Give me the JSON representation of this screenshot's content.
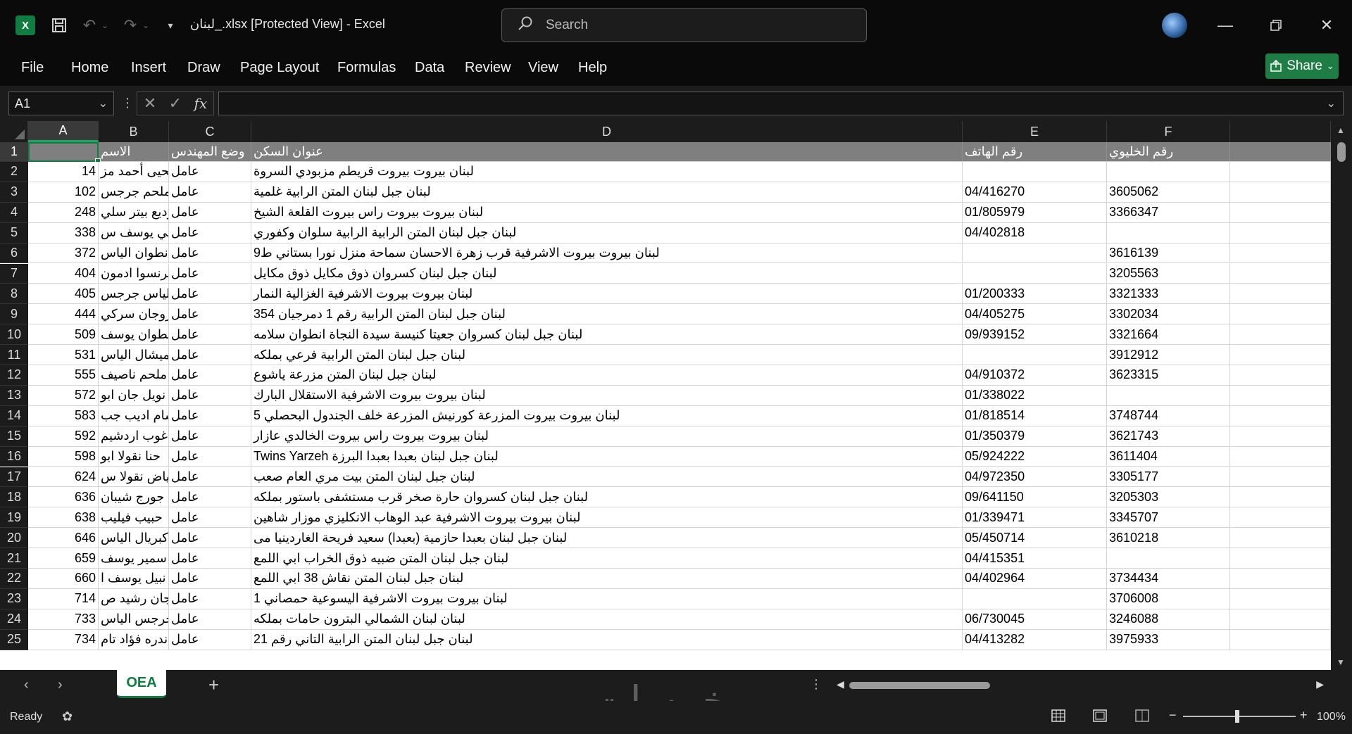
{
  "window": {
    "title": "لبنان_.xlsx  [Protected View]  -  Excel",
    "search_placeholder": "Search"
  },
  "menu": [
    "File",
    "Home",
    "Insert",
    "Draw",
    "Page Layout",
    "Formulas",
    "Data",
    "Review",
    "View",
    "Help"
  ],
  "share_label": "Share",
  "formula_bar": {
    "name_box": "A1",
    "fx": "fx",
    "content": ""
  },
  "columns": [
    "A",
    "B",
    "C",
    "D",
    "E",
    "F"
  ],
  "header_row": {
    "A": "",
    "B": "الاسم",
    "C": "وضع المهندس",
    "D": "عنوان السكن",
    "E": "رقم الهاتف",
    "F": "رقم الخليوي"
  },
  "rows": [
    {
      "n": "2",
      "a": "14",
      "b": "يحيى أحمد مز",
      "c": "عامل",
      "d": "لبنان  بيروت  بيروت  قريطم   مزبودي  السروة",
      "e": "",
      "f": ""
    },
    {
      "n": "3",
      "a": "102",
      "b": "ملحم جرجس",
      "c": "عامل",
      "d": "لبنان  جبل لبنان  المتن  الرابية  غلمية",
      "e": "04/416270",
      "f": "3605062"
    },
    {
      "n": "4",
      "a": "248",
      "b": "وديع بيتر سلي",
      "c": "عامل",
      "d": "لبنان  بيروت  بيروت  راس بيروت  القلعة  الشيخ",
      "e": "01/805979",
      "f": "3366347"
    },
    {
      "n": "5",
      "a": "338",
      "b": "ايلي يوسف س",
      "c": "عامل",
      "d": "لبنان  جبل لبنان  المتن  الرابية  الرابية  سلوان وكفوري",
      "e": "04/402818",
      "f": ""
    },
    {
      "n": "6",
      "a": "372",
      "b": "انطوان الياس",
      "c": "عامل",
      "d": "لبنان  بيروت  بيروت  الاشرفية  قرب زهرة الاحسان  سماحة   منزل نورا بستاني ط9",
      "e": "",
      "f": "3616139"
    },
    {
      "n": "7",
      "a": "404",
      "b": "فرنسوا ادمون",
      "c": "عامل",
      "d": "لبنان  جبل لبنان  كسروان  ذوق مكايل  ذوق مكايل",
      "e": "",
      "f": "3205563"
    },
    {
      "n": "8",
      "a": "405",
      "b": "الياس جرجس",
      "c": "عامل",
      "d": "لبنان  بيروت  بيروت  الاشرفية  الغزالية  النمار",
      "e": "01/200333",
      "f": "3321333"
    },
    {
      "n": "9",
      "a": "444",
      "b": "واروجان سركي",
      "c": "عامل",
      "d": "لبنان  جبل لبنان  المتن  الرابية  رقم 1   دمرجيان 354",
      "e": "04/405275",
      "f": "3302034"
    },
    {
      "n": "10",
      "a": "509",
      "b": "انطوان يوسف",
      "c": "عامل",
      "d": "لبنان  جبل لبنان  كسروان  جعيتا  كنيسة سيدة النجاة  انطوان سلامه",
      "e": "09/939152",
      "f": "3321664"
    },
    {
      "n": "11",
      "a": "531",
      "b": "ميشال الياس",
      "c": "عامل",
      "d": "لبنان  جبل لبنان  المتن  الرابية  فرعي  بملكه",
      "e": "",
      "f": "3912912"
    },
    {
      "n": "12",
      "a": "555",
      "b": "ملحم ناصيف",
      "c": "عامل",
      "d": "لبنان  جبل لبنان  المتن  مزرعة ياشوع",
      "e": "04/910372",
      "f": "3623315"
    },
    {
      "n": "13",
      "a": "572",
      "b": "نويل جان ابو",
      "c": "عامل",
      "d": "لبنان  بيروت  بيروت  الاشرفية  الاستقلال  البارك",
      "e": "01/338022",
      "f": ""
    },
    {
      "n": "14",
      "a": "583",
      "b": "بسام اديب جب",
      "c": "عامل",
      "d": "لبنان  بيروت  بيروت  المزرعة  كورنيش المزرعة   خلف الجندول  البحصلي  5",
      "e": "01/818514",
      "f": "3748744"
    },
    {
      "n": "15",
      "a": "592",
      "b": "اغوب اردشيم",
      "c": "عامل",
      "d": "لبنان  بيروت  بيروت  راس بيروت  الخالدي  عازار",
      "e": "01/350379",
      "f": "3621743"
    },
    {
      "n": "16",
      "a": "598",
      "b": "حنا نقولا ابو",
      "c": "عامل",
      "d": "لبنان  جبل لبنان  بعبدا  بعبدا  البرزة  Twins Yarzeh",
      "e": "05/924222",
      "f": "3611404"
    },
    {
      "n": "17",
      "a": "624",
      "b": "رياض نقولا س",
      "c": "عامل",
      "d": "لبنان  جبل لبنان  المتن  بيت مري  العام  صعب",
      "e": "04/972350",
      "f": "3305177"
    },
    {
      "n": "18",
      "a": "636",
      "b": "جورج شيبان",
      "c": "عامل",
      "d": "لبنان  جبل لبنان  كسروان  حارة صخر  قرب مستشفى باستور  بملكه",
      "e": "09/641150",
      "f": "3205303"
    },
    {
      "n": "19",
      "a": "638",
      "b": "حبيب فيليب",
      "c": "عامل",
      "d": "لبنان  بيروت  بيروت  الاشرفية  عبد الوهاب الانكليزي  موزار شاهين",
      "e": "01/339471",
      "f": "3345707"
    },
    {
      "n": "20",
      "a": "646",
      "b": "كبريال الياس",
      "c": "عامل",
      "d": "لبنان  جبل لبنان  بعبدا  حازمية (بعبدا)  سعيد فريحة   الغاردينيا  مى",
      "e": "05/450714",
      "f": "3610218"
    },
    {
      "n": "21",
      "a": "659",
      "b": "سمير يوسف",
      "c": "عامل",
      "d": "لبنان  جبل لبنان  المتن  ضبيه  ذوق الخراب  ابي اللمع",
      "e": "04/415351",
      "f": ""
    },
    {
      "n": "22",
      "a": "660",
      "b": "نبيل يوسف ا",
      "c": "عامل",
      "d": "لبنان  جبل لبنان  المتن  نقاش  38  ابي اللمع",
      "e": "04/402964",
      "f": "3734434"
    },
    {
      "n": "23",
      "a": "714",
      "b": "جان رشيد ص",
      "c": "عامل",
      "d": "لبنان  بيروت  بيروت  الاشرفية  اليسوعية  حمصاني  1",
      "e": "",
      "f": "3706008"
    },
    {
      "n": "24",
      "a": "733",
      "b": "جرجس الياس",
      "c": "عامل",
      "d": "لبنان  لبنان الشمالي  البترون  حامات  بملكه",
      "e": "06/730045",
      "f": "3246088"
    },
    {
      "n": "25",
      "a": "734",
      "b": "اندره فؤاد تام",
      "c": "عامل",
      "d": "لبنان  جبل لبنان  المتن  الرابية  التاني  رقم 21",
      "e": "04/413282",
      "f": "3975933"
    }
  ],
  "sheet_tab": "OEA",
  "status": {
    "ready": "Ready",
    "zoom": "100%"
  },
  "watermark": "خمسات"
}
